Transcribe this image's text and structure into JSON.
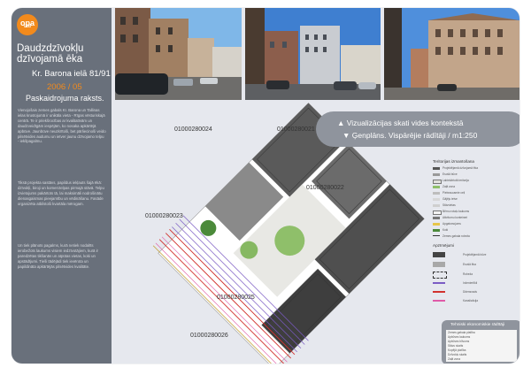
{
  "logo": {
    "text": "opa",
    "sub": "Ltd"
  },
  "sidebar": {
    "title": "Daudzdzīvokļu dzīvojamā ēka",
    "address": "Kr. Barona ielā 81/91",
    "date": "2006 / 05",
    "subtitle": "Paskaidrojuma raksts.",
    "paragraph1": "Vienojošais zemes gabals Kr. Barona un Tallinas ielas krustojumā ir unikāla vieta - Rīgas vēsturiskajā centrā. Te ir priekšrocības ar kvalitatīvām un daudzveidīgām iespējām, ko nosaka apkārtējā apbūve. Jaunbūve neuzkrītoši, bet pārliecinoši veido pilsētvides audumu un ietver jaunu dzīvojamo telpu - iekšpagalmu.",
    "paragraph2": "Tiksā projekta sastāvs, papildus iekļauts šajā ēkā: dzīvokļi, biroji un komerctelpas pirmajā stāvā. Telpu izvietojums pakārtots tā, lai maksimāli nodrošinātu dienasgaismas pieejamību un vēdināšanu. Fasāde organizēta atbilstoši kvartāla mērogam.",
    "paragraph3": "Un tiek plānots pagalms, kurā netiek nodalīts ierobežots laukums visiem iedzīvotājiem, kurā ir paredzētas tikšanās un atpūtas vietas, koki un apstādījumi. Tieši tādējādi tiek ievērota un papildināta apkārtējās pilsētvides kvalitāte."
  },
  "banner": {
    "line1": "▲ Vizualizācijas skati vides kontekstā",
    "line2": "▼ Ģenplāns. Vispārējie rādītāji / m1:250"
  },
  "plan_labels": [
    "01000280024",
    "01000280021",
    "01000280022",
    "01000280023",
    "01000280025",
    "01000280026"
  ],
  "legend": {
    "section1_title": "Teritorijas izmantošana",
    "section1_items": [
      "Projektējamā dzīvojamā ēka",
      "Esošā būve",
      "Labiekārtotā teritorija",
      "Zaļā zona",
      "Piebraucamie ceļi",
      "Gājēju ietve",
      "Stāvvietas",
      "Bērnu rotaļu laukums",
      "Atkritumu konteineri",
      "Apgaismojums",
      "Koki",
      "Zemes gabala robeža"
    ],
    "section2_title": "Apzīmējumi",
    "section2_items": [
      "Projektējamā būve",
      "Esošā ēka",
      "Robeža",
      "Inženiertīkli",
      "Ūdensvads",
      "Kanalizācija"
    ]
  },
  "stats": {
    "title": "Tehniski ekonomiskie rādītāji",
    "rows": [
      "Zemes gabala platība",
      "Apbūves laukums",
      "Apbūves blīvums",
      "Stāvu skaits",
      "Kopējā platība",
      "Dzīvokļu skaits",
      "Zaļā zona"
    ]
  }
}
